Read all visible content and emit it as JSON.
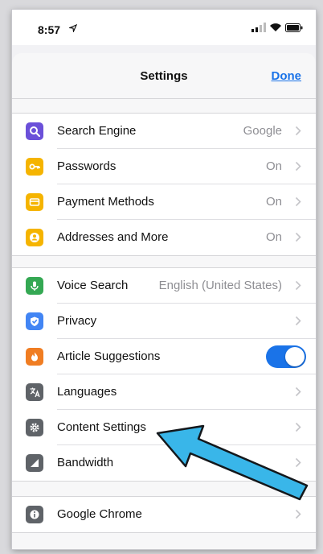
{
  "status": {
    "time": "8:57"
  },
  "nav": {
    "title": "Settings",
    "done_label": "Done"
  },
  "groups": [
    [
      {
        "label": "Search Engine",
        "value": "Google",
        "icon": "search-icon",
        "color": "#6b50d9"
      },
      {
        "label": "Passwords",
        "value": "On",
        "icon": "key-icon",
        "color": "#f5b400"
      },
      {
        "label": "Payment Methods",
        "value": "On",
        "icon": "card-icon",
        "color": "#f5b400"
      },
      {
        "label": "Addresses and More",
        "value": "On",
        "icon": "person-icon",
        "color": "#f5b400"
      }
    ],
    [
      {
        "label": "Voice Search",
        "value": "English (United States)",
        "icon": "microphone-icon",
        "color": "#34a853"
      },
      {
        "label": "Privacy",
        "value": "",
        "icon": "shield-icon",
        "color": "#4285f4"
      },
      {
        "label": "Article Suggestions",
        "value": "",
        "icon": "flame-icon",
        "color": "#f07d22",
        "toggle": "on"
      },
      {
        "label": "Languages",
        "value": "",
        "icon": "translate-icon",
        "color": "#5f6368"
      },
      {
        "label": "Content Settings",
        "value": "",
        "icon": "gear-icon",
        "color": "#5f6368"
      },
      {
        "label": "Bandwidth",
        "value": "",
        "icon": "signal-icon",
        "color": "#5f6368"
      }
    ],
    [
      {
        "label": "Google Chrome",
        "value": "",
        "icon": "info-icon",
        "color": "#5f6368"
      }
    ]
  ],
  "colors": {
    "accent": "#1a73e8",
    "arrow": "#39b6e9"
  }
}
